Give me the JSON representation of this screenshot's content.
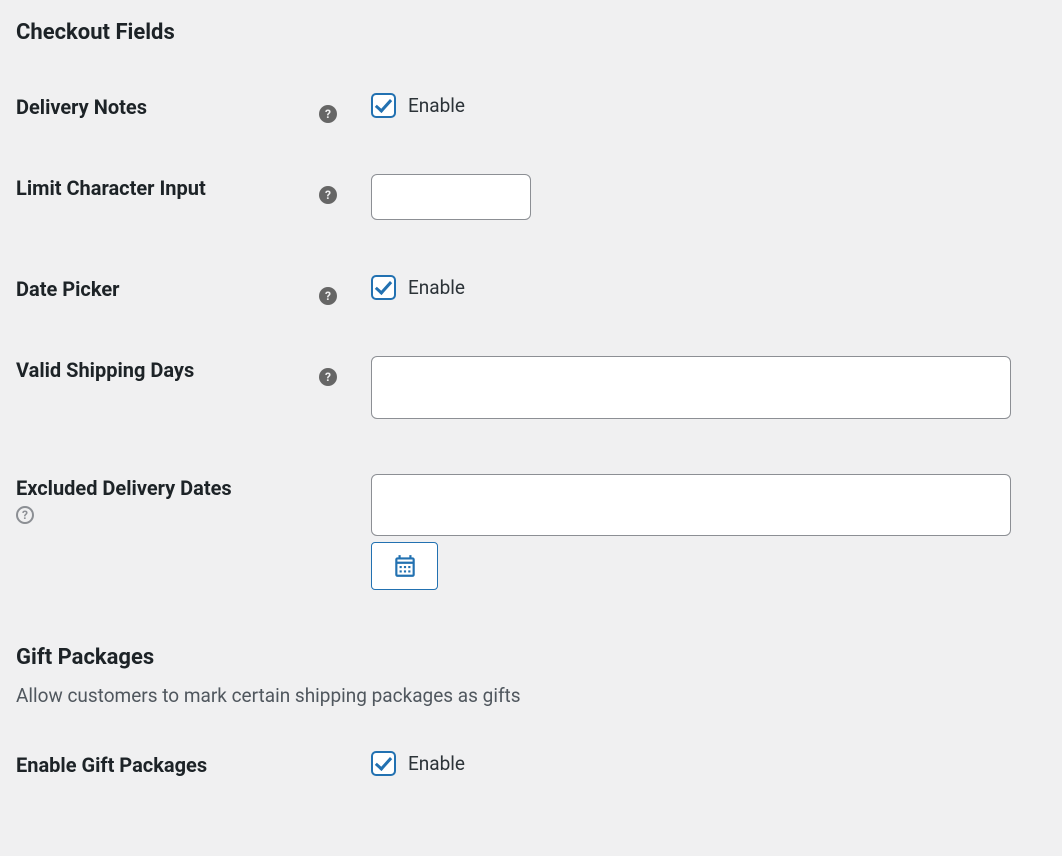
{
  "sections": {
    "checkout_fields": {
      "title": "Checkout Fields"
    },
    "gift_packages": {
      "title": "Gift Packages",
      "description": "Allow customers to mark certain shipping packages as gifts"
    }
  },
  "fields": {
    "delivery_notes": {
      "label": "Delivery Notes",
      "checkbox_label": "Enable",
      "checked": true
    },
    "limit_character_input": {
      "label": "Limit Character Input",
      "value": ""
    },
    "date_picker": {
      "label": "Date Picker",
      "checkbox_label": "Enable",
      "checked": true
    },
    "valid_shipping_days": {
      "label": "Valid Shipping Days",
      "value": ""
    },
    "excluded_delivery_dates": {
      "label": "Excluded Delivery Dates",
      "value": ""
    },
    "enable_gift_packages": {
      "label": "Enable Gift Packages",
      "checkbox_label": "Enable",
      "checked": true
    }
  }
}
